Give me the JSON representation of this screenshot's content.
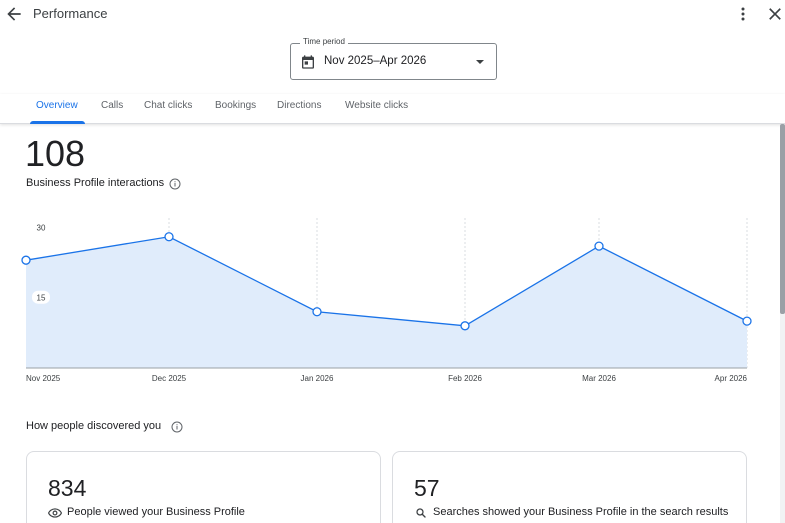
{
  "header": {
    "title": "Performance",
    "back_icon": "arrow-back-icon",
    "more_icon": "more-vert-icon",
    "close_icon": "close-icon"
  },
  "time_period": {
    "label": "Time period",
    "value": "Nov 2025–Apr 2026",
    "icon": "calendar-icon"
  },
  "tabs": [
    {
      "label": "Overview",
      "active": true
    },
    {
      "label": "Calls",
      "active": false
    },
    {
      "label": "Chat clicks",
      "active": false
    },
    {
      "label": "Bookings",
      "active": false
    },
    {
      "label": "Directions",
      "active": false
    },
    {
      "label": "Website clicks",
      "active": false
    }
  ],
  "summary": {
    "total": "108",
    "label": "Business Profile interactions"
  },
  "chart_data": {
    "type": "area",
    "x": [
      "Nov 2025",
      "Dec 2025",
      "Jan 2026",
      "Feb 2026",
      "Mar 2026",
      "Apr 2026"
    ],
    "series": [
      {
        "values": [
          23,
          28,
          12,
          9,
          26,
          10
        ]
      }
    ],
    "y_ticks": [
      15,
      30
    ],
    "ylim": [
      0,
      32
    ],
    "grid": "vertical dashed",
    "colors": {
      "line": "#1a73e8",
      "fill": "#e0ecfb"
    }
  },
  "discovery": {
    "title": "How people discovered you",
    "cards": [
      {
        "value": "834",
        "desc": "People viewed your Business Profile",
        "icon": "eye-icon"
      },
      {
        "value": "57",
        "desc": "Searches showed your Business Profile in the search results",
        "icon": "search-icon"
      }
    ]
  }
}
